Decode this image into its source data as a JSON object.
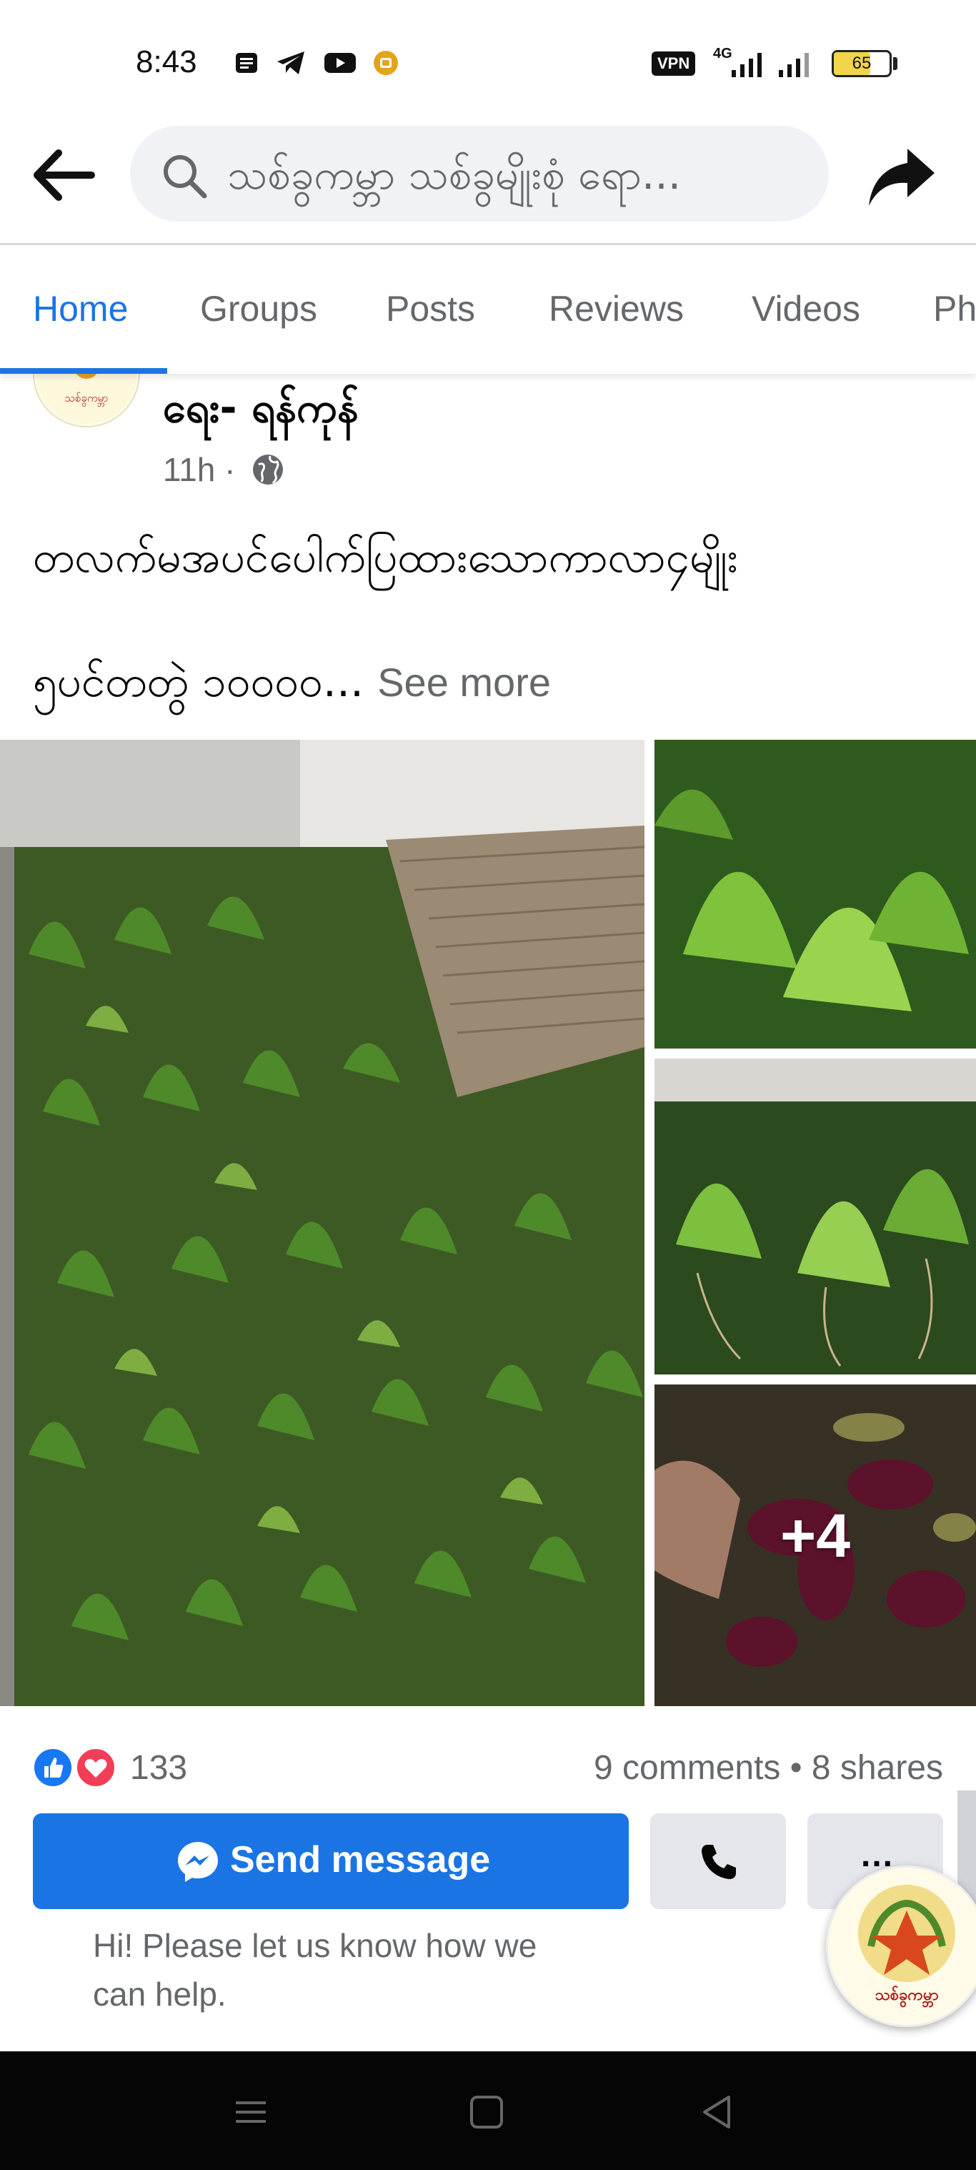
{
  "status_bar": {
    "time": "8:43",
    "network": "4G",
    "vpn_label": "VPN",
    "battery_level": "65",
    "battery_fraction": 0.65,
    "icons": [
      "notes-icon",
      "telegram-icon",
      "youtube-icon",
      "app-icon",
      "vpn-icon",
      "mobile-data-icon",
      "signal-icon",
      "signal-icon-2",
      "battery-icon"
    ]
  },
  "search": {
    "query": "သစ်ခွကမ္ဘာ သစ်ခွမျိုးစုံ ရော..."
  },
  "tabs": [
    {
      "label": "Home",
      "active": true
    },
    {
      "label": "Groups",
      "active": false
    },
    {
      "label": "Posts",
      "active": false
    },
    {
      "label": "Reviews",
      "active": false
    },
    {
      "label": "Videos",
      "active": false
    },
    {
      "label": "Ph",
      "active": false
    }
  ],
  "post": {
    "author_name": "ရေး- ရန်ကုန်",
    "time": "11h",
    "separator": "·",
    "privacy_icon": "globe-icon",
    "text_line1": "တလက်မအပင်ပေါက်ပြထားသောကာလာ၄မျိုး",
    "text_line2": "၅ပင်တတွဲ ၁၀၀၀၀...",
    "see_more": "See more",
    "more_photos": "+4",
    "reactions": {
      "count": "133",
      "types": [
        "like-icon",
        "love-icon"
      ]
    },
    "comments_shares": "9 comments • 8 shares"
  },
  "actions": {
    "send_message": "Send message",
    "more": "..."
  },
  "greeting": "Hi! Please let us know how we can help.",
  "colors": {
    "brand_blue": "#1b74e4",
    "tab_active": "#1b74e4",
    "secondary_text": "#65676b",
    "button_gray": "#e4e6eb",
    "like_blue": "#1877f2",
    "love_red": "#f33e58"
  }
}
